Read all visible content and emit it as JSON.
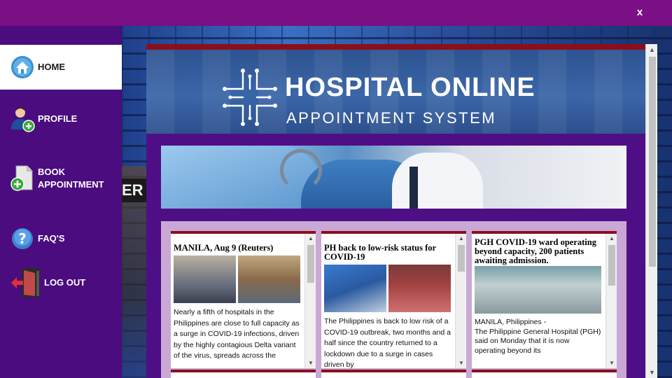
{
  "window": {
    "close_label": "x"
  },
  "sidebar": {
    "items": [
      {
        "label": "HOME",
        "icon": "home-icon",
        "active": true
      },
      {
        "label": "PROFILE",
        "icon": "user-add-icon",
        "active": false
      },
      {
        "label_line1": "BOOK",
        "label_line2": "APPOINTMENT",
        "icon": "document-add-icon",
        "active": false
      },
      {
        "label": "FAQ'S",
        "icon": "help-icon",
        "active": false
      },
      {
        "label": "LOG OUT",
        "icon": "logout-door-icon",
        "active": false
      }
    ]
  },
  "background": {
    "sign_text": "ER"
  },
  "banner": {
    "title": "HOSPITAL ONLINE",
    "subtitle": "APPOINTMENT SYSTEM"
  },
  "news": [
    {
      "title": "MANILA, Aug 9 (Reuters)",
      "text": "Nearly a fifth of hospitals in the Philippines are close to full capacity as a surge in COVID-19 infections, driven by the highly contagious Delta variant of the virus, spreads across the"
    },
    {
      "title": "PH back to low-risk status for COVID-19",
      "text": "The Philippines is back to low risk of a COVID-19 outbreak, two months and a half since the country returned to a lockdown due to a surge in cases driven by"
    },
    {
      "title": "PGH COVID-19 ward operating beyond capacity, 200 patients awaiting admission.",
      "text_line1": "MANILA, Philippines -",
      "text_line2": "The Philippine General Hospital (PGH) said on Monday that it is now operating beyond its"
    }
  ],
  "colors": {
    "titlebar": "#7a0f86",
    "sidebar": "#4a0c7e",
    "content_bg": "#4e0f86",
    "accent_line": "#8b0f1a",
    "news_panel": "#c9a8d6"
  }
}
